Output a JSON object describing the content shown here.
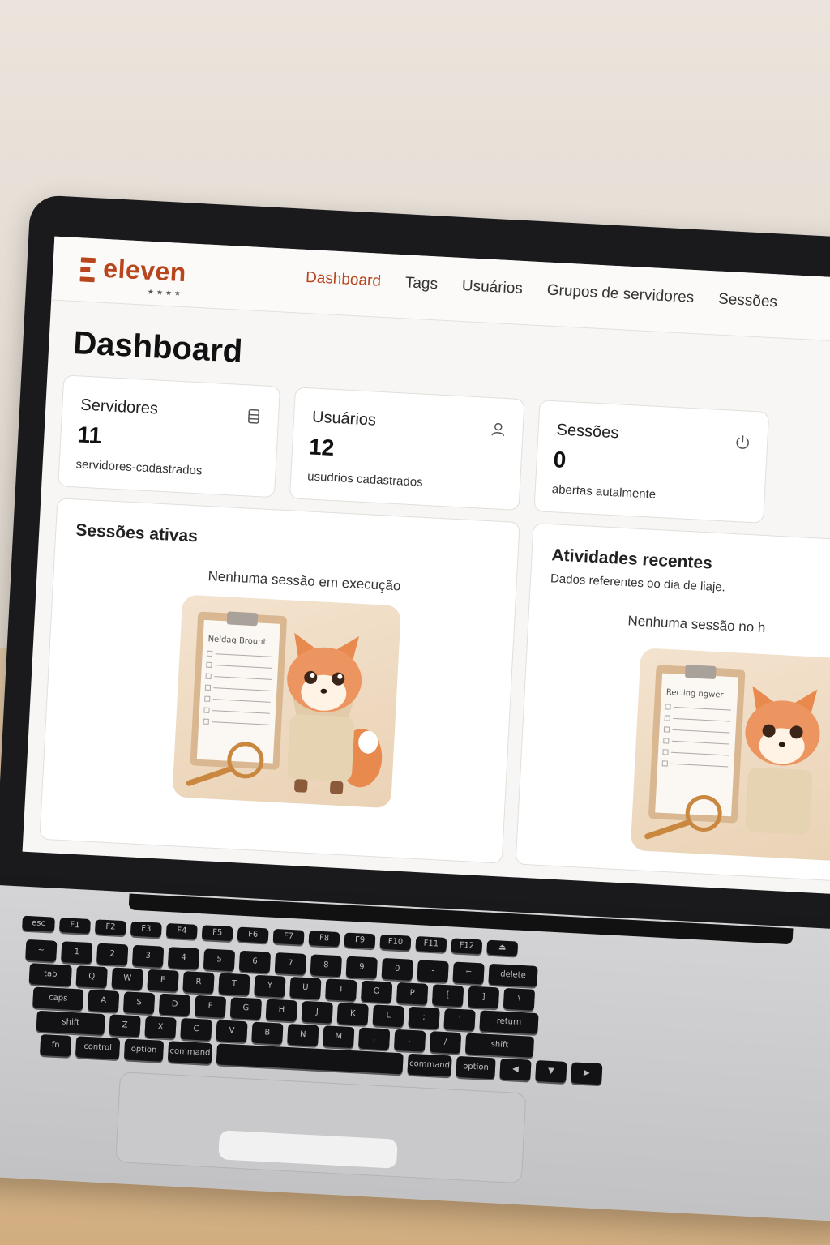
{
  "app": {
    "logo_text": "eleven",
    "logo_dots": "★★★★",
    "brand_color": "#b8451e"
  },
  "nav": {
    "items": [
      {
        "label": "Dashboard",
        "active": true
      },
      {
        "label": "Tags",
        "active": false
      },
      {
        "label": "Usuários",
        "active": false
      },
      {
        "label": "Grupos de servidores",
        "active": false
      },
      {
        "label": "Sessões",
        "active": false
      }
    ]
  },
  "page": {
    "title": "Dashboard"
  },
  "stats": [
    {
      "title": "Servidores",
      "value": "11",
      "caption": "servidores-cadastrados",
      "icon": "server-icon"
    },
    {
      "title": "Usuários",
      "value": "12",
      "caption": "usudrios cadastrados",
      "icon": "user-icon"
    },
    {
      "title": "Sessões",
      "value": "0",
      "caption": "abertas autalmente",
      "icon": "power-icon"
    }
  ],
  "active_sessions": {
    "title": "Sessões ativas",
    "empty_message": "Nenhuma sessão em execução",
    "illustration_text": "Neldag Brount"
  },
  "recent_activity": {
    "title": "Atividades recentes",
    "subtitle": "Dados referentes oo dia de liaje.",
    "empty_message": "Nenhuma sessão no h",
    "illustration_text": "Reciing ngwer"
  },
  "keyboard": {
    "rows": [
      [
        "esc",
        "F1",
        "F2",
        "F3",
        "F4",
        "F5",
        "F6",
        "F7",
        "F8",
        "F9",
        "F10",
        "F11",
        "F12",
        "⏏"
      ],
      [
        "~",
        "1",
        "2",
        "3",
        "4",
        "5",
        "6",
        "7",
        "8",
        "9",
        "0",
        "-",
        "=",
        "delete"
      ],
      [
        "tab",
        "Q",
        "W",
        "E",
        "R",
        "T",
        "Y",
        "U",
        "I",
        "O",
        "P",
        "[",
        "]",
        "\\"
      ],
      [
        "caps",
        "A",
        "S",
        "D",
        "F",
        "G",
        "H",
        "J",
        "K",
        "L",
        ";",
        "'",
        "return"
      ],
      [
        "shift",
        "Z",
        "X",
        "C",
        "V",
        "B",
        "N",
        "M",
        ",",
        ".",
        "/",
        "shift"
      ],
      [
        "fn",
        "control",
        "option",
        "command",
        "",
        "command",
        "option",
        "◀",
        "▼",
        "▶"
      ]
    ]
  }
}
